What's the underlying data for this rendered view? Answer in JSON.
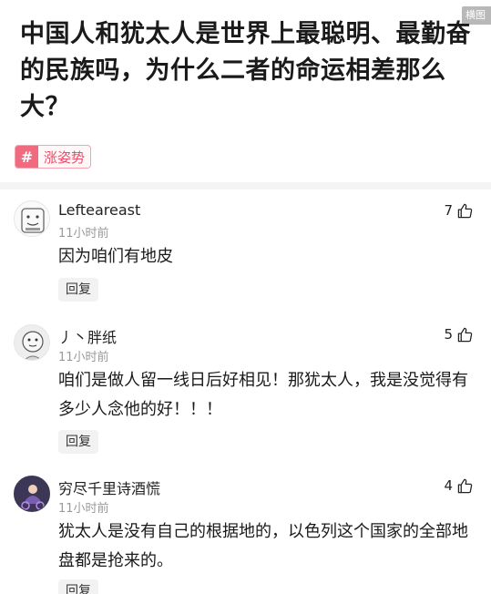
{
  "corner_tag": "横图",
  "question": {
    "title": "中国人和犹太人是世界上最聪明、最勤奋的民族吗，为什么二者的命运相差那么大？"
  },
  "topic_tag": {
    "hash": "#",
    "label": "涨姿势"
  },
  "comments": [
    {
      "username": "Lefteareast",
      "time": "11小时前",
      "text": "因为咱们有地皮",
      "likes": "7",
      "reply_label": "回复"
    },
    {
      "username": "丿丶胖纸",
      "time": "11小时前",
      "text": "咱们是做人留一线日后好相见！那犹太人，我是没觉得有多少人念他的好！！！",
      "likes": "5",
      "reply_label": "回复"
    },
    {
      "username": "穷尽千里诗酒慌",
      "time": "11小时前",
      "text": "犹太人是没有自己的根据地的，以色列这个国家的全部地盘都是抢来的。",
      "likes": "4",
      "reply_label": "回复"
    }
  ]
}
